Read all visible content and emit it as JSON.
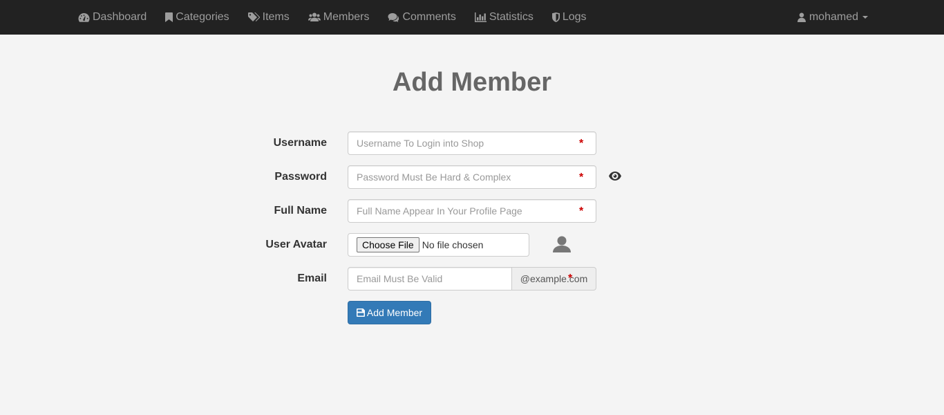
{
  "nav": {
    "items": [
      {
        "label": "Dashboard",
        "icon": "dashboard-icon"
      },
      {
        "label": "Categories",
        "icon": "bookmark-icon"
      },
      {
        "label": "Items",
        "icon": "tags-icon"
      },
      {
        "label": "Members",
        "icon": "users-icon"
      },
      {
        "label": "Comments",
        "icon": "comments-icon"
      },
      {
        "label": "Statistics",
        "icon": "bar-chart-icon"
      },
      {
        "label": "Logs",
        "icon": "shield-icon"
      }
    ],
    "user": {
      "name": "mohamed",
      "icon": "user-icon"
    }
  },
  "page": {
    "title": "Add Member"
  },
  "form": {
    "username": {
      "label": "Username",
      "placeholder": "Username To Login into Shop",
      "required_mark": "*"
    },
    "password": {
      "label": "Password",
      "placeholder": "Password Must Be Hard & Complex",
      "required_mark": "*",
      "toggle_icon": "eye-icon"
    },
    "fullname": {
      "label": "Full Name",
      "placeholder": "Full Name Appear In Your Profile Page",
      "required_mark": "*"
    },
    "avatar": {
      "label": "User Avatar",
      "button_label": "Choose File",
      "status": "No file chosen",
      "preview_icon": "user-avatar-icon"
    },
    "email": {
      "label": "Email",
      "placeholder": "Email Must Be Valid",
      "addon": "@example.com",
      "required_mark": "*"
    },
    "submit": {
      "label": "Add Member",
      "icon": "save-icon"
    }
  },
  "colors": {
    "navbar": "#222222",
    "nav_text": "#9d9d9d",
    "primary": "#337ab7",
    "required": "#cc0000",
    "background": "#f4f4f4"
  }
}
